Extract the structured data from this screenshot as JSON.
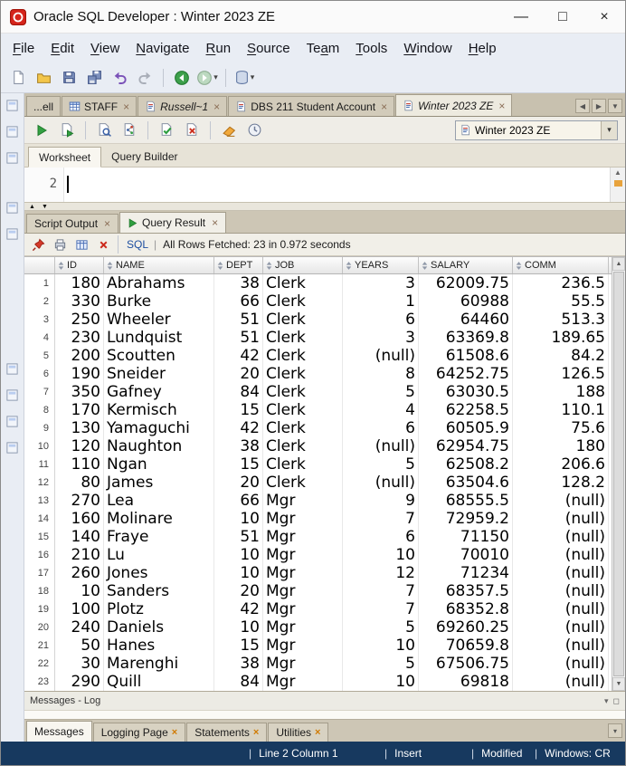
{
  "window": {
    "title": "Oracle SQL Developer : Winter 2023 ZE",
    "minimize_label": "—",
    "maximize_label": "□",
    "close_label": "×"
  },
  "menu": {
    "items": [
      {
        "label": "File",
        "mnemonic": "F"
      },
      {
        "label": "Edit",
        "mnemonic": "E"
      },
      {
        "label": "View",
        "mnemonic": "V"
      },
      {
        "label": "Navigate",
        "mnemonic": "N"
      },
      {
        "label": "Run",
        "mnemonic": "R"
      },
      {
        "label": "Source",
        "mnemonic": "S"
      },
      {
        "label": "Team",
        "mnemonic": "a"
      },
      {
        "label": "Tools",
        "mnemonic": "T"
      },
      {
        "label": "Window",
        "mnemonic": "W"
      },
      {
        "label": "Help",
        "mnemonic": "H"
      }
    ]
  },
  "toolbar": {
    "icons": [
      "new-file",
      "open-folder",
      "save",
      "save-all",
      "undo",
      "redo",
      "separator",
      "back",
      "forward",
      "separator",
      "connections"
    ]
  },
  "document_tabs": [
    {
      "label": "...ell",
      "icon": "none",
      "active": false,
      "closable": false,
      "italic": false
    },
    {
      "label": "STAFF",
      "icon": "table",
      "active": false,
      "closable": true,
      "italic": false
    },
    {
      "label": "Russell~1",
      "icon": "sql",
      "active": false,
      "closable": true,
      "italic": true
    },
    {
      "label": "DBS 211 Student Account",
      "icon": "sql",
      "active": false,
      "closable": true,
      "italic": false
    },
    {
      "label": "Winter 2023 ZE",
      "icon": "sql",
      "active": true,
      "closable": true,
      "italic": true
    }
  ],
  "worksheet_toolbar": {
    "icons": [
      "run-statement",
      "run-script",
      "separator",
      "autotrace",
      "explain-plan",
      "separator",
      "commit",
      "rollback",
      "separator",
      "clear",
      "history"
    ]
  },
  "worksheet": {
    "connection": "Winter 2023 ZE",
    "tabs": [
      "Worksheet",
      "Query Builder"
    ],
    "editor_line_number": "2"
  },
  "results": {
    "tabs": [
      {
        "label": "Script Output",
        "icon": "none",
        "active": false
      },
      {
        "label": "Query Result",
        "icon": "play",
        "active": true
      }
    ],
    "sql_label": "SQL",
    "status": "All Rows Fetched: 23 in 0.972 seconds"
  },
  "result_toolbar": {
    "icons": [
      "pin",
      "print",
      "fetch-grid",
      "delete-result"
    ]
  },
  "grid": {
    "columns": [
      "ID",
      "NAME",
      "DEPT",
      "JOB",
      "YEARS",
      "SALARY",
      "COMM"
    ],
    "rows": [
      [
        "180",
        "Abrahams",
        "38",
        "Clerk",
        "3",
        "62009.75",
        "236.5"
      ],
      [
        "330",
        "Burke",
        "66",
        "Clerk",
        "1",
        "60988",
        "55.5"
      ],
      [
        "250",
        "Wheeler",
        "51",
        "Clerk",
        "6",
        "64460",
        "513.3"
      ],
      [
        "230",
        "Lundquist",
        "51",
        "Clerk",
        "3",
        "63369.8",
        "189.65"
      ],
      [
        "200",
        "Scoutten",
        "42",
        "Clerk",
        "(null)",
        "61508.6",
        "84.2"
      ],
      [
        "190",
        "Sneider",
        "20",
        "Clerk",
        "8",
        "64252.75",
        "126.5"
      ],
      [
        "350",
        "Gafney",
        "84",
        "Clerk",
        "5",
        "63030.5",
        "188"
      ],
      [
        "170",
        "Kermisch",
        "15",
        "Clerk",
        "4",
        "62258.5",
        "110.1"
      ],
      [
        "130",
        "Yamaguchi",
        "42",
        "Clerk",
        "6",
        "60505.9",
        "75.6"
      ],
      [
        "120",
        "Naughton",
        "38",
        "Clerk",
        "(null)",
        "62954.75",
        "180"
      ],
      [
        "110",
        "Ngan",
        "15",
        "Clerk",
        "5",
        "62508.2",
        "206.6"
      ],
      [
        "80",
        "James",
        "20",
        "Clerk",
        "(null)",
        "63504.6",
        "128.2"
      ],
      [
        "270",
        "Lea",
        "66",
        "Mgr",
        "9",
        "68555.5",
        "(null)"
      ],
      [
        "160",
        "Molinare",
        "10",
        "Mgr",
        "7",
        "72959.2",
        "(null)"
      ],
      [
        "140",
        "Fraye",
        "51",
        "Mgr",
        "6",
        "71150",
        "(null)"
      ],
      [
        "210",
        "Lu",
        "10",
        "Mgr",
        "10",
        "70010",
        "(null)"
      ],
      [
        "260",
        "Jones",
        "10",
        "Mgr",
        "12",
        "71234",
        "(null)"
      ],
      [
        "10",
        "Sanders",
        "20",
        "Mgr",
        "7",
        "68357.5",
        "(null)"
      ],
      [
        "100",
        "Plotz",
        "42",
        "Mgr",
        "7",
        "68352.8",
        "(null)"
      ],
      [
        "240",
        "Daniels",
        "10",
        "Mgr",
        "5",
        "69260.25",
        "(null)"
      ],
      [
        "50",
        "Hanes",
        "15",
        "Mgr",
        "10",
        "70659.8",
        "(null)"
      ],
      [
        "30",
        "Marenghi",
        "38",
        "Mgr",
        "5",
        "67506.75",
        "(null)"
      ],
      [
        "290",
        "Quill",
        "84",
        "Mgr",
        "10",
        "69818",
        "(null)"
      ]
    ]
  },
  "messages_panel": {
    "title": "Messages - Log",
    "tabs": [
      {
        "label": "Messages",
        "active": true,
        "closable": false
      },
      {
        "label": "Logging Page",
        "active": false,
        "closable": true
      },
      {
        "label": "Statements",
        "active": false,
        "closable": true
      },
      {
        "label": "Utilities",
        "active": false,
        "closable": true
      }
    ]
  },
  "status_bar": {
    "items": [
      "Line 2 Column 1",
      "Insert",
      "Modified",
      "Windows: CR"
    ]
  },
  "colors": {
    "status_bar_bg": "#17395f",
    "tab_strip_bg": "#c8c1af",
    "accent_red": "#d6251c",
    "run_green": "#33a042"
  }
}
